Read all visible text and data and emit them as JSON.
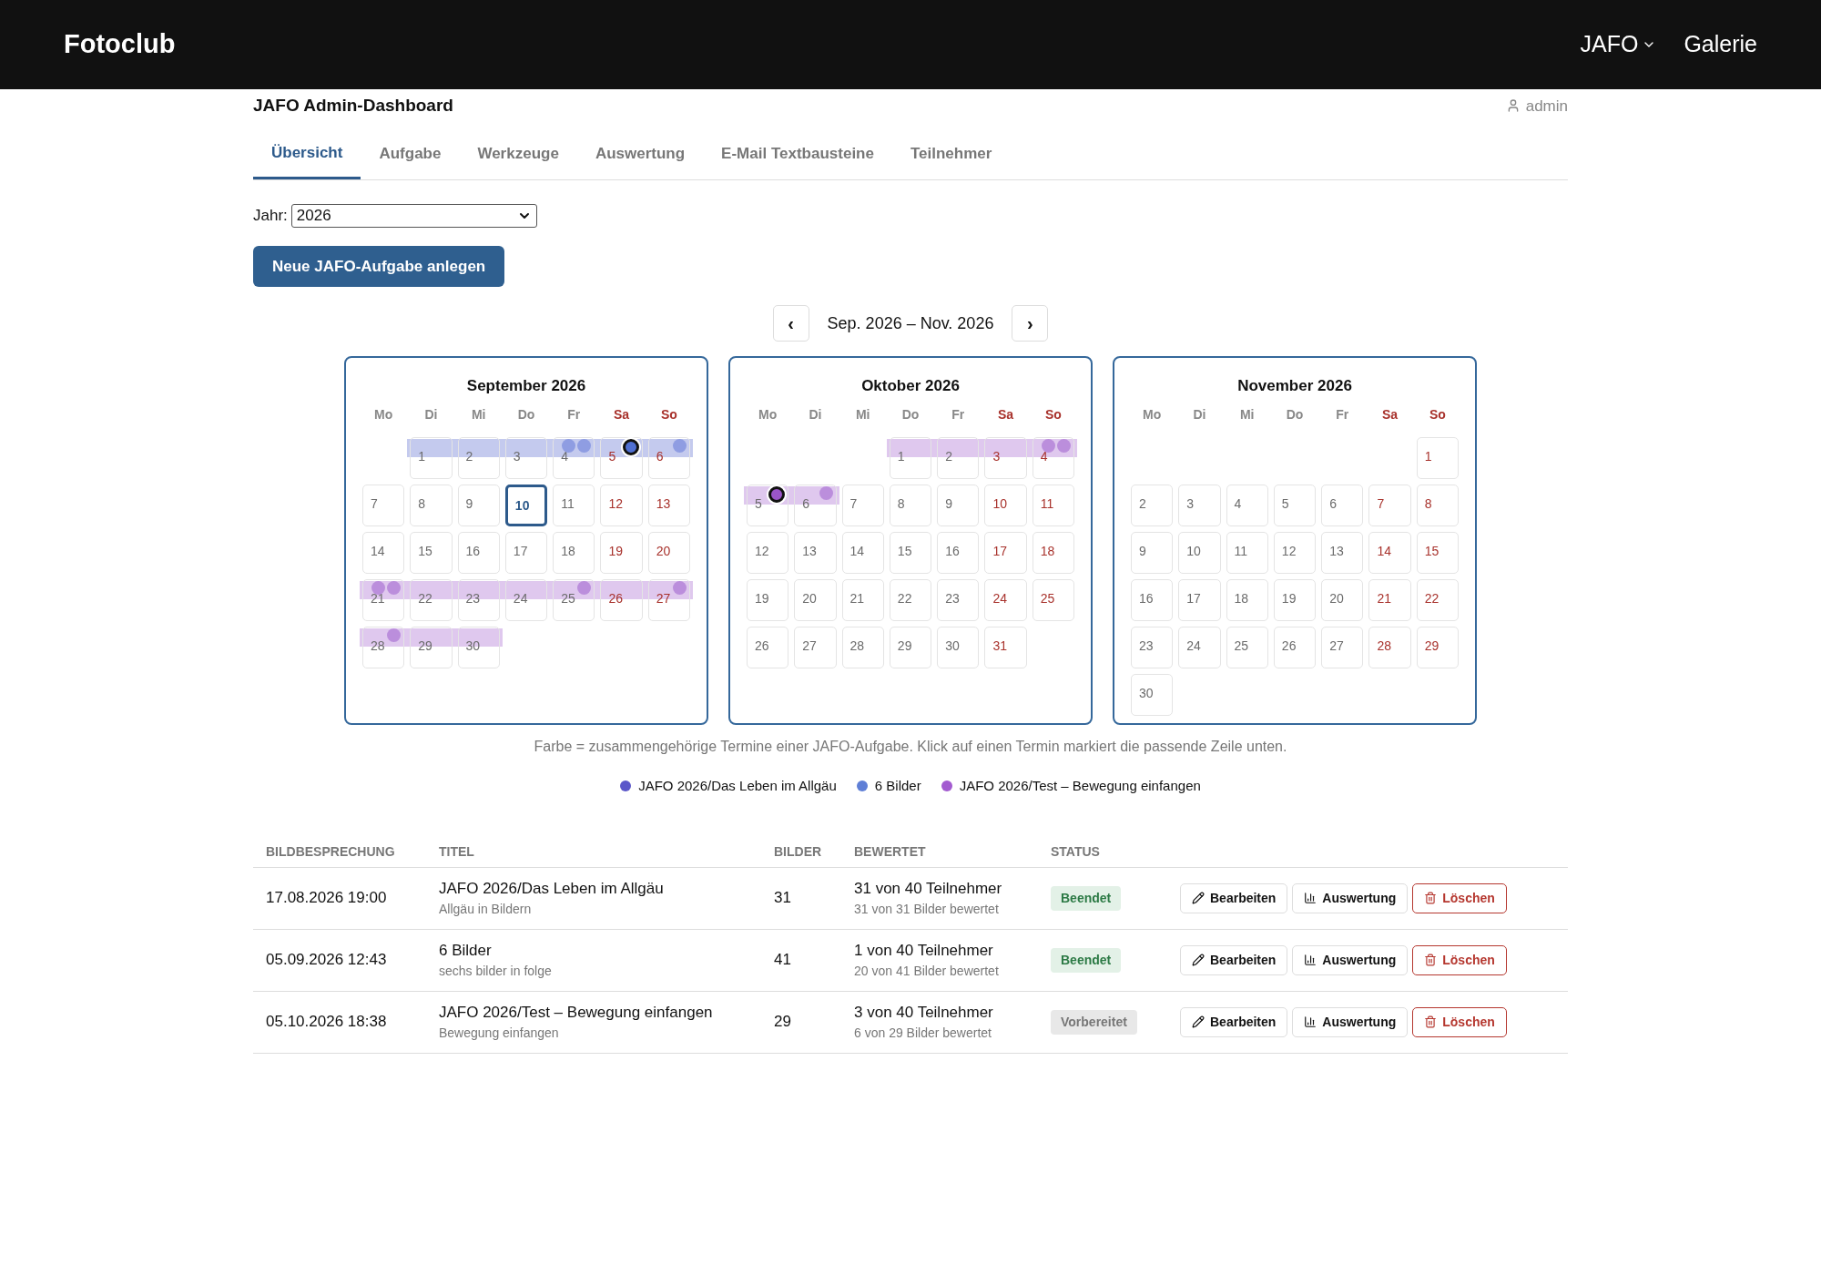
{
  "header": {
    "logo": "Fotoclub",
    "nav": [
      {
        "label": "JAFO",
        "kind": "dropdown"
      },
      {
        "label": "Galerie",
        "kind": "link"
      }
    ]
  },
  "page": {
    "title": "JAFO Admin-Dashboard",
    "user": "admin"
  },
  "tabs": [
    {
      "label": "Übersicht",
      "selected": true
    },
    {
      "label": "Aufgabe",
      "selected": false
    },
    {
      "label": "Werkzeuge",
      "selected": false
    },
    {
      "label": "Auswertung",
      "selected": false
    },
    {
      "label": "E-Mail Textbausteine",
      "selected": false
    },
    {
      "label": "Teilnehmer",
      "selected": false
    }
  ],
  "year": {
    "label": "Jahr:",
    "value": "2026"
  },
  "create_button": "Neue JAFO-Aufgabe anlegen",
  "range": {
    "prev": "‹",
    "label": "Sep. 2026 – Nov. 2026",
    "next": "›"
  },
  "months": [
    {
      "title": "September 2026",
      "weekdays": [
        "Mo",
        "Di",
        "Mi",
        "Do",
        "Fr",
        "Sa",
        "So"
      ],
      "days": [
        {
          "kind": "blank"
        },
        {
          "kind": "day",
          "day": "1",
          "today": false,
          "color": "#c4caee"
        },
        {
          "kind": "day",
          "day": "2",
          "today": false,
          "color": "#c4caee"
        },
        {
          "kind": "day",
          "day": "3",
          "today": false,
          "color": "#c4caee"
        },
        {
          "kind": "day",
          "day": "4",
          "today": false,
          "color": "#c4caee",
          "dots": [
            {
              "color": "#8f9de2",
              "selected": false
            },
            {
              "color": "#8f9de2",
              "selected": false
            }
          ]
        },
        {
          "kind": "day",
          "day": "5",
          "today": false,
          "color": "#c4caee",
          "dots": [
            {
              "color": "#4f6fd2",
              "selected": true
            }
          ]
        },
        {
          "kind": "day",
          "day": "6",
          "today": false,
          "color": "#c4caee",
          "dots": [
            {
              "color": "#8f9de2",
              "selected": false
            }
          ]
        },
        {
          "kind": "day",
          "day": "7",
          "today": false
        },
        {
          "kind": "day",
          "day": "8",
          "today": false
        },
        {
          "kind": "day",
          "day": "9",
          "today": false
        },
        {
          "kind": "day",
          "day": "10",
          "today": true
        },
        {
          "kind": "day",
          "day": "11",
          "today": false
        },
        {
          "kind": "day",
          "day": "12",
          "today": false
        },
        {
          "kind": "day",
          "day": "13",
          "today": false
        },
        {
          "kind": "day",
          "day": "14",
          "today": false
        },
        {
          "kind": "day",
          "day": "15",
          "today": false
        },
        {
          "kind": "day",
          "day": "16",
          "today": false
        },
        {
          "kind": "day",
          "day": "17",
          "today": false
        },
        {
          "kind": "day",
          "day": "18",
          "today": false
        },
        {
          "kind": "day",
          "day": "19",
          "today": false
        },
        {
          "kind": "day",
          "day": "20",
          "today": false
        },
        {
          "kind": "day",
          "day": "21",
          "today": false,
          "color": "#dfc8ee",
          "dots": [
            {
              "color": "#bb8edc",
              "selected": false
            },
            {
              "color": "#bb8edc",
              "selected": false
            }
          ]
        },
        {
          "kind": "day",
          "day": "22",
          "today": false,
          "color": "#dfc8ee"
        },
        {
          "kind": "day",
          "day": "23",
          "today": false,
          "color": "#dfc8ee"
        },
        {
          "kind": "day",
          "day": "24",
          "today": false,
          "color": "#dfc8ee"
        },
        {
          "kind": "day",
          "day": "25",
          "today": false,
          "color": "#dfc8ee",
          "dots": [
            {
              "color": "#bb8edc",
              "selected": false
            }
          ]
        },
        {
          "kind": "day",
          "day": "26",
          "today": false,
          "color": "#dfc8ee"
        },
        {
          "kind": "day",
          "day": "27",
          "today": false,
          "color": "#dfc8ee",
          "dots": [
            {
              "color": "#bb8edc",
              "selected": false
            }
          ]
        },
        {
          "kind": "day",
          "day": "28",
          "today": false,
          "color": "#dfc8ee",
          "dots": [
            {
              "color": "#bb8edc",
              "selected": false
            }
          ]
        },
        {
          "kind": "day",
          "day": "29",
          "today": false,
          "color": "#dfc8ee"
        },
        {
          "kind": "day",
          "day": "30",
          "today": false,
          "color": "#dfc8ee"
        }
      ]
    },
    {
      "title": "Oktober 2026",
      "weekdays": [
        "Mo",
        "Di",
        "Mi",
        "Do",
        "Fr",
        "Sa",
        "So"
      ],
      "days": [
        {
          "kind": "blank"
        },
        {
          "kind": "blank"
        },
        {
          "kind": "blank"
        },
        {
          "kind": "day",
          "day": "1",
          "today": false,
          "color": "#dfc8ee"
        },
        {
          "kind": "day",
          "day": "2",
          "today": false,
          "color": "#dfc8ee"
        },
        {
          "kind": "day",
          "day": "3",
          "today": false,
          "color": "#dfc8ee"
        },
        {
          "kind": "day",
          "day": "4",
          "today": false,
          "color": "#dfc8ee",
          "dots": [
            {
              "color": "#bb8edc",
              "selected": false
            },
            {
              "color": "#bb8edc",
              "selected": false
            }
          ]
        },
        {
          "kind": "day",
          "day": "5",
          "today": false,
          "color": "#dfc8ee",
          "dots": [
            {
              "color": "#9b55c9",
              "selected": true
            }
          ]
        },
        {
          "kind": "day",
          "day": "6",
          "today": false,
          "color": "#dfc8ee",
          "dots": [
            {
              "color": "#bb8edc",
              "selected": false
            }
          ]
        },
        {
          "kind": "day",
          "day": "7",
          "today": false
        },
        {
          "kind": "day",
          "day": "8",
          "today": false
        },
        {
          "kind": "day",
          "day": "9",
          "today": false
        },
        {
          "kind": "day",
          "day": "10",
          "today": false
        },
        {
          "kind": "day",
          "day": "11",
          "today": false
        },
        {
          "kind": "day",
          "day": "12",
          "today": false
        },
        {
          "kind": "day",
          "day": "13",
          "today": false
        },
        {
          "kind": "day",
          "day": "14",
          "today": false
        },
        {
          "kind": "day",
          "day": "15",
          "today": false
        },
        {
          "kind": "day",
          "day": "16",
          "today": false
        },
        {
          "kind": "day",
          "day": "17",
          "today": false
        },
        {
          "kind": "day",
          "day": "18",
          "today": false
        },
        {
          "kind": "day",
          "day": "19",
          "today": false
        },
        {
          "kind": "day",
          "day": "20",
          "today": false
        },
        {
          "kind": "day",
          "day": "21",
          "today": false
        },
        {
          "kind": "day",
          "day": "22",
          "today": false
        },
        {
          "kind": "day",
          "day": "23",
          "today": false
        },
        {
          "kind": "day",
          "day": "24",
          "today": false
        },
        {
          "kind": "day",
          "day": "25",
          "today": false
        },
        {
          "kind": "day",
          "day": "26",
          "today": false
        },
        {
          "kind": "day",
          "day": "27",
          "today": false
        },
        {
          "kind": "day",
          "day": "28",
          "today": false
        },
        {
          "kind": "day",
          "day": "29",
          "today": false
        },
        {
          "kind": "day",
          "day": "30",
          "today": false
        },
        {
          "kind": "day",
          "day": "31",
          "today": false
        }
      ]
    },
    {
      "title": "November 2026",
      "weekdays": [
        "Mo",
        "Di",
        "Mi",
        "Do",
        "Fr",
        "Sa",
        "So"
      ],
      "days": [
        {
          "kind": "blank"
        },
        {
          "kind": "blank"
        },
        {
          "kind": "blank"
        },
        {
          "kind": "blank"
        },
        {
          "kind": "blank"
        },
        {
          "kind": "blank"
        },
        {
          "kind": "day",
          "day": "1",
          "today": false
        },
        {
          "kind": "day",
          "day": "2",
          "today": false
        },
        {
          "kind": "day",
          "day": "3",
          "today": false
        },
        {
          "kind": "day",
          "day": "4",
          "today": false
        },
        {
          "kind": "day",
          "day": "5",
          "today": false
        },
        {
          "kind": "day",
          "day": "6",
          "today": false
        },
        {
          "kind": "day",
          "day": "7",
          "today": false
        },
        {
          "kind": "day",
          "day": "8",
          "today": false
        },
        {
          "kind": "day",
          "day": "9",
          "today": false
        },
        {
          "kind": "day",
          "day": "10",
          "today": false
        },
        {
          "kind": "day",
          "day": "11",
          "today": false
        },
        {
          "kind": "day",
          "day": "12",
          "today": false
        },
        {
          "kind": "day",
          "day": "13",
          "today": false
        },
        {
          "kind": "day",
          "day": "14",
          "today": false
        },
        {
          "kind": "day",
          "day": "15",
          "today": false
        },
        {
          "kind": "day",
          "day": "16",
          "today": false
        },
        {
          "kind": "day",
          "day": "17",
          "today": false
        },
        {
          "kind": "day",
          "day": "18",
          "today": false
        },
        {
          "kind": "day",
          "day": "19",
          "today": false
        },
        {
          "kind": "day",
          "day": "20",
          "today": false
        },
        {
          "kind": "day",
          "day": "21",
          "today": false
        },
        {
          "kind": "day",
          "day": "22",
          "today": false
        },
        {
          "kind": "day",
          "day": "23",
          "today": false
        },
        {
          "kind": "day",
          "day": "24",
          "today": false
        },
        {
          "kind": "day",
          "day": "25",
          "today": false
        },
        {
          "kind": "day",
          "day": "26",
          "today": false
        },
        {
          "kind": "day",
          "day": "27",
          "today": false
        },
        {
          "kind": "day",
          "day": "28",
          "today": false
        },
        {
          "kind": "day",
          "day": "29",
          "today": false
        },
        {
          "kind": "day",
          "day": "30",
          "today": false
        }
      ]
    }
  ],
  "hint": "Farbe = zusammengehörige Termine einer JAFO-Aufgabe. Klick auf einen Termin markiert die passende Zeile unten.",
  "legend": [
    {
      "label": "JAFO 2026/Das Leben im Allgäu",
      "color": "#5b57c9"
    },
    {
      "label": "6 Bilder",
      "color": "#5f7fd6"
    },
    {
      "label": "JAFO 2026/Test – Bewegung einfangen",
      "color": "#a35bd0"
    }
  ],
  "table": {
    "columns": [
      "BILDBESPRECHUNG",
      "TITEL",
      "BILDER",
      "BEWERTET",
      "STATUS"
    ],
    "rows": [
      {
        "date": "17.08.2026 19:00",
        "title": "JAFO 2026/Das Leben im Allgäu",
        "subtitle": "Allgäu in Bildern",
        "images": "31",
        "rated": "31 von 40 Teilnehmer",
        "rated_detail": "31 von 31 Bilder bewertet",
        "status": {
          "label": "Beendet",
          "kind": "finished"
        },
        "actions": [
          {
            "label": "Bearbeiten",
            "kind": "edit"
          },
          {
            "label": "Auswertung",
            "kind": "stats"
          },
          {
            "label": "Löschen",
            "kind": "delete"
          }
        ]
      },
      {
        "date": "05.09.2026 12:43",
        "title": "6 Bilder",
        "subtitle": "sechs bilder in folge",
        "images": "41",
        "rated": "1 von 40 Teilnehmer",
        "rated_detail": "20 von 41 Bilder bewertet",
        "status": {
          "label": "Beendet",
          "kind": "finished"
        },
        "actions": [
          {
            "label": "Bearbeiten",
            "kind": "edit"
          },
          {
            "label": "Auswertung",
            "kind": "stats"
          },
          {
            "label": "Löschen",
            "kind": "delete"
          }
        ]
      },
      {
        "date": "05.10.2026 18:38",
        "title": "JAFO 2026/Test – Bewegung einfangen",
        "subtitle": "Bewegung einfangen",
        "images": "29",
        "rated": "3 von 40 Teilnehmer",
        "rated_detail": "6 von 29 Bilder bewertet",
        "status": {
          "label": "Vorbereitet",
          "kind": "prepared"
        },
        "actions": [
          {
            "label": "Bearbeiten",
            "kind": "edit"
          },
          {
            "label": "Auswertung",
            "kind": "stats"
          },
          {
            "label": "Löschen",
            "kind": "delete"
          }
        ]
      }
    ]
  }
}
